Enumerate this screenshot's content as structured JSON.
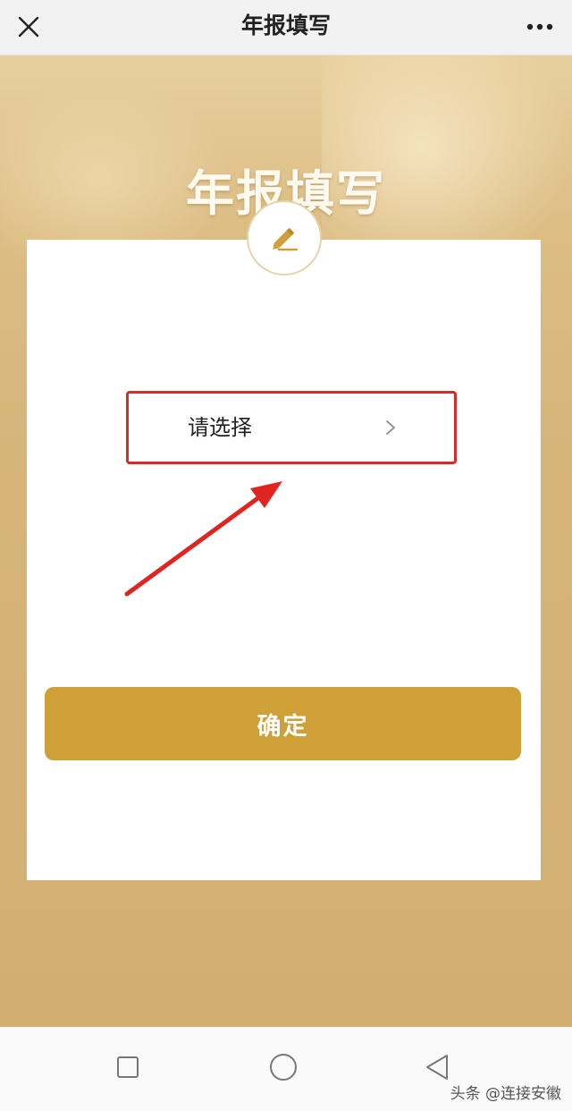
{
  "topbar": {
    "title": "年报填写",
    "close_icon": "close-icon",
    "more_icon": "more-icon"
  },
  "hero": {
    "title": "年报填写",
    "badge_icon": "pencil-icon"
  },
  "form": {
    "select_placeholder": "请选择",
    "select_icon": "chevron-right-icon",
    "confirm_label": "确定"
  },
  "colors": {
    "accent": "#cf9f38",
    "highlight": "#d92a2a",
    "hero_bg": "#d6b57b"
  },
  "navbar": {
    "icons": [
      "square-icon",
      "circle-icon",
      "back-triangle-icon"
    ]
  },
  "watermark": {
    "text": "头条 @连接安徽"
  }
}
